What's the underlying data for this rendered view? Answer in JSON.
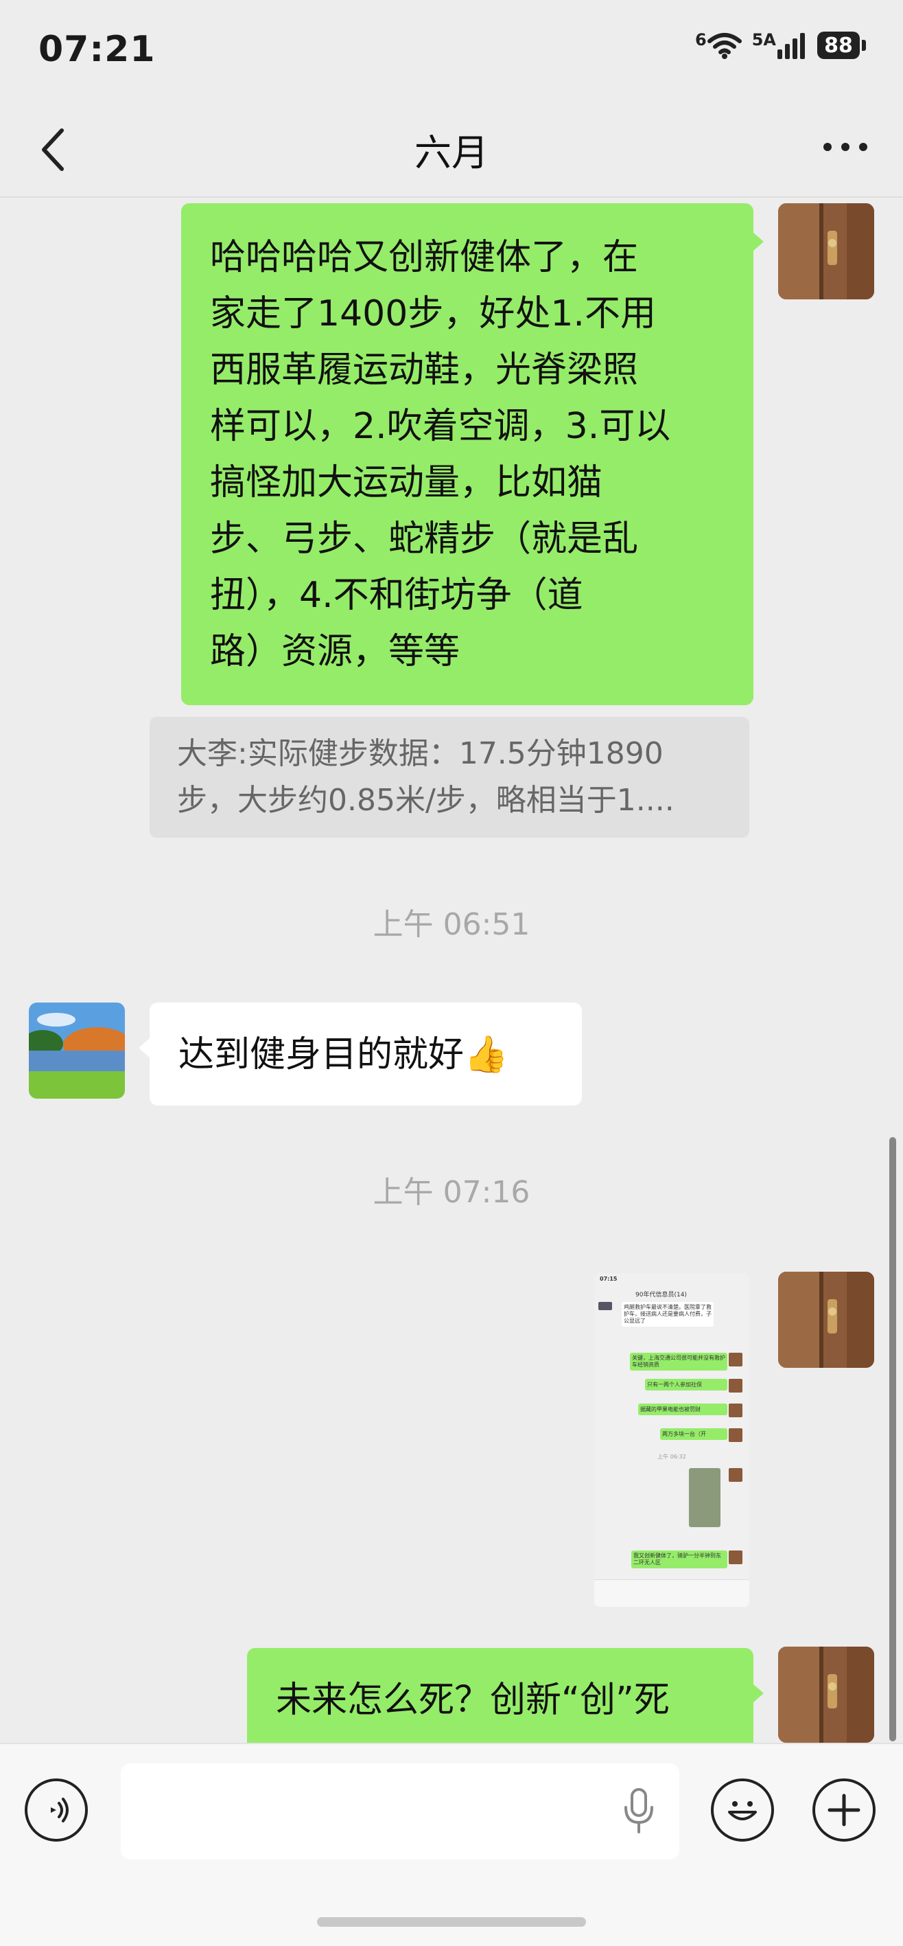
{
  "status_bar": {
    "time": "07:21",
    "wifi_label": "6",
    "signal_label": "5A",
    "battery": "88"
  },
  "header": {
    "title": "六月",
    "back_icon": "chevron-left-icon",
    "more_icon": "more-dots-icon"
  },
  "messages": {
    "m1": {
      "side": "right",
      "lines": [
        "哈哈哈哈又创新健体了，在",
        "家走了1400步，好处1.不用",
        "西服革履运动鞋，光脊梁照",
        "样可以，2.吹着空调，3.可以",
        "搞怪加大运动量，比如猫",
        "步、弓步、蛇精步（就是乱",
        "扭），4.不和街坊争（道",
        "路）资源，等等"
      ]
    },
    "quote": {
      "line1": "大李:实际健步数据：17.5分钟1890",
      "line2": "步，大步约0.85米/步，略相当于1...."
    },
    "ts1": "上午 06:51",
    "m2": {
      "side": "left",
      "text": "达到健身目的就好",
      "emoji": "👍"
    },
    "ts2": "上午 07:16",
    "screenshot_thumb": {
      "time": "07:15",
      "title": "90年代信息员(14)",
      "left_msg": "鸡腿救护车最说不清楚。医院拿了救护车，接送病人还是要病人付费，子公显远了",
      "r1": "关键，上海交通公司很可能并没有救护车经销资质",
      "r2": "只有一两个人参加社保",
      "r3": "据藏的甲果电能也被罚财",
      "r4": "两万多块一台（开",
      "ts": "上午 06:32",
      "r5": "我又创新健体了，骑驴一分半钟到东二环无人区"
    },
    "m3": {
      "side": "right",
      "text": "未来怎么死？创新“创”死"
    }
  },
  "input_bar": {
    "voice_icon": "voice-icon",
    "mic_icon": "microphone-icon",
    "emoji_icon": "emoji-icon",
    "add_icon": "plus-icon",
    "input_value": ""
  },
  "colors": {
    "background": "#ededed",
    "green_bubble": "#95ec69",
    "white_bubble": "#ffffff",
    "timestamp": "#a8a8a8"
  }
}
